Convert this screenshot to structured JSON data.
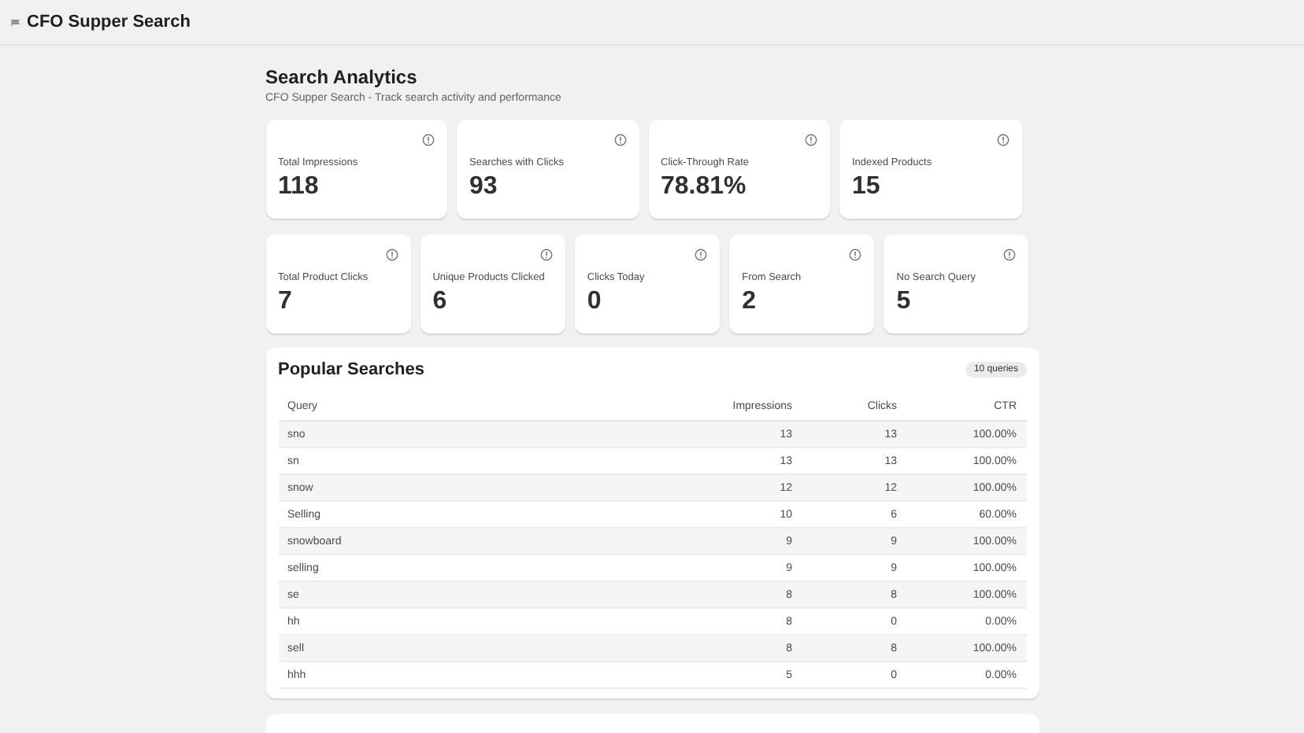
{
  "app_title": "CFO Supper Search",
  "page": {
    "title": "Search Analytics",
    "subtitle": "CFO Supper Search - Track search activity and performance"
  },
  "primary_stats": [
    {
      "label": "Total Impressions",
      "value": "118"
    },
    {
      "label": "Searches with Clicks",
      "value": "93"
    },
    {
      "label": "Click-Through Rate",
      "value": "78.81%"
    },
    {
      "label": "Indexed Products",
      "value": "15"
    }
  ],
  "secondary_stats": [
    {
      "label": "Total Product Clicks",
      "value": "7"
    },
    {
      "label": "Unique Products Clicked",
      "value": "6"
    },
    {
      "label": "Clicks Today",
      "value": "0"
    },
    {
      "label": "From Search",
      "value": "2"
    },
    {
      "label": "No Search Query",
      "value": "5"
    }
  ],
  "popular_searches": {
    "title": "Popular Searches",
    "badge": "10 queries",
    "columns": [
      "Query",
      "Impressions",
      "Clicks",
      "CTR"
    ],
    "rows": [
      [
        "sno",
        "13",
        "13",
        "100.00%"
      ],
      [
        "sn",
        "13",
        "13",
        "100.00%"
      ],
      [
        "snow",
        "12",
        "12",
        "100.00%"
      ],
      [
        "Selling",
        "10",
        "6",
        "60.00%"
      ],
      [
        "snowboard",
        "9",
        "9",
        "100.00%"
      ],
      [
        "selling",
        "9",
        "9",
        "100.00%"
      ],
      [
        "se",
        "8",
        "8",
        "100.00%"
      ],
      [
        "hh",
        "8",
        "0",
        "0.00%"
      ],
      [
        "sell",
        "8",
        "8",
        "100.00%"
      ],
      [
        "hhh",
        "5",
        "0",
        "0.00%"
      ]
    ]
  }
}
